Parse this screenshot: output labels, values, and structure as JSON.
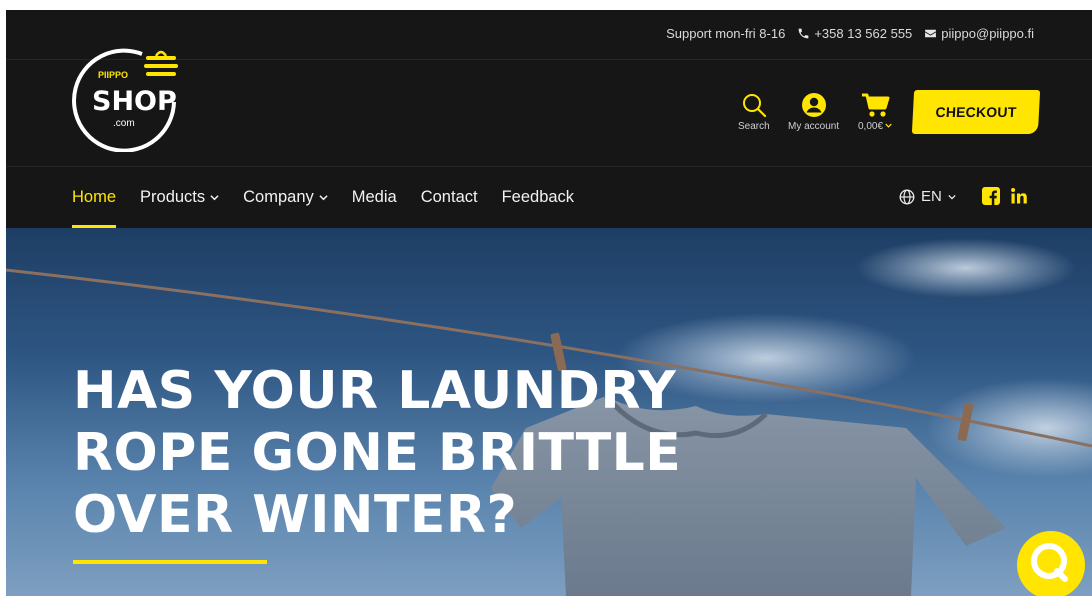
{
  "support": {
    "hours": "Support mon-fri 8-16",
    "phone": "+358 13 562 555",
    "email": "piippo@piippo.fi",
    "phone_icon": "phone-icon",
    "mail_icon": "mail-icon"
  },
  "logo": {
    "brand": "PIIPPO",
    "name": "SHOP",
    "suffix": ".com"
  },
  "header": {
    "search_label": "Search",
    "account_label": "My account",
    "cart_total": "0,00€",
    "checkout_label": "CHECKOUT"
  },
  "nav": {
    "items": [
      {
        "label": "Home",
        "active": true,
        "dropdown": false
      },
      {
        "label": "Products",
        "active": false,
        "dropdown": true
      },
      {
        "label": "Company",
        "active": false,
        "dropdown": true
      },
      {
        "label": "Media",
        "active": false,
        "dropdown": false
      },
      {
        "label": "Contact",
        "active": false,
        "dropdown": false
      },
      {
        "label": "Feedback",
        "active": false,
        "dropdown": false
      }
    ],
    "language": "EN"
  },
  "hero": {
    "title": "HAS YOUR LAUNDRY\nROPE GONE BRITTLE\nOVER WINTER?"
  },
  "colors": {
    "accent": "#ffe500",
    "header_bg": "#161616",
    "text_light": "#f2f2f2"
  }
}
